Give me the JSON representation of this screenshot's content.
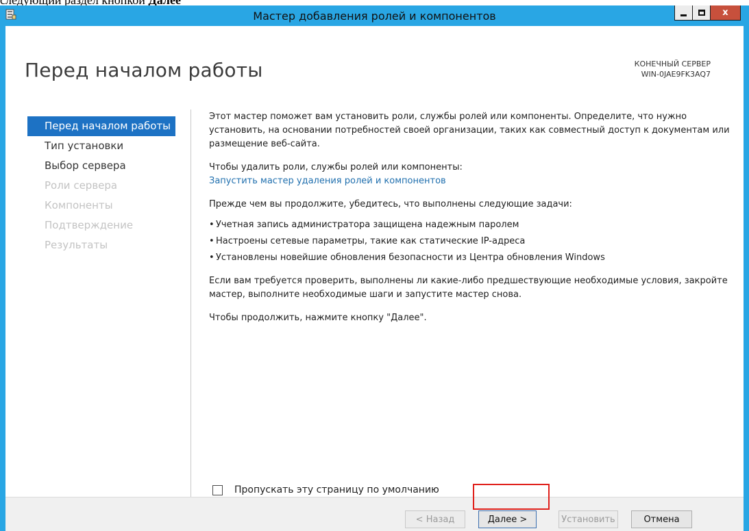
{
  "doc_fragment": {
    "prefix": "следующий раздел кнопкой ",
    "bold": "Далее"
  },
  "window": {
    "title": "Мастер добавления ролей и компонентов",
    "close_label": "x"
  },
  "header": {
    "page_title": "Перед началом работы",
    "dest_label": "КОНЕЧНЫЙ СЕРВЕР",
    "dest_value": "WIN-0JAE9FK3AQ7"
  },
  "nav": {
    "items": [
      {
        "label": "Перед началом работы",
        "state": "active"
      },
      {
        "label": "Тип установки",
        "state": "enabled"
      },
      {
        "label": "Выбор сервера",
        "state": "enabled"
      },
      {
        "label": "Роли сервера",
        "state": "disabled"
      },
      {
        "label": "Компоненты",
        "state": "disabled"
      },
      {
        "label": "Подтверждение",
        "state": "disabled"
      },
      {
        "label": "Результаты",
        "state": "disabled"
      }
    ]
  },
  "content": {
    "intro": "Этот мастер поможет вам установить роли, службы ролей или компоненты. Определите, что нужно установить, на основании потребностей своей организации, таких как совместный доступ к документам или размещение веб-сайта.",
    "remove_text": "Чтобы удалить роли, службы ролей или компоненты:",
    "remove_link": "Запустить мастер удаления ролей и компонентов",
    "prereq_text": "Прежде чем вы продолжите, убедитесь, что выполнены следующие задачи:",
    "bullets": [
      "Учетная запись администратора защищена надежным паролем",
      "Настроены сетевые параметры, такие как статические IP-адреса",
      "Установлены новейшие обновления безопасности из Центра обновления Windows"
    ],
    "verify_text": "Если вам требуется проверить, выполнены ли какие-либо предшествующие необходимые условия, закройте мастер, выполните необходимые шаги и запустите мастер снова.",
    "continue_text": "Чтобы продолжить, нажмите кнопку \"Далее\".",
    "skip_label": "Пропускать эту страницу по умолчанию",
    "skip_checked": false
  },
  "footer": {
    "back": "< Назад",
    "next": "Далее >",
    "install": "Установить",
    "cancel": "Отмена"
  },
  "colors": {
    "titlebar": "#29a6e4",
    "nav_active": "#1d72c4",
    "link": "#1f6fae",
    "highlight": "#e0201b"
  }
}
